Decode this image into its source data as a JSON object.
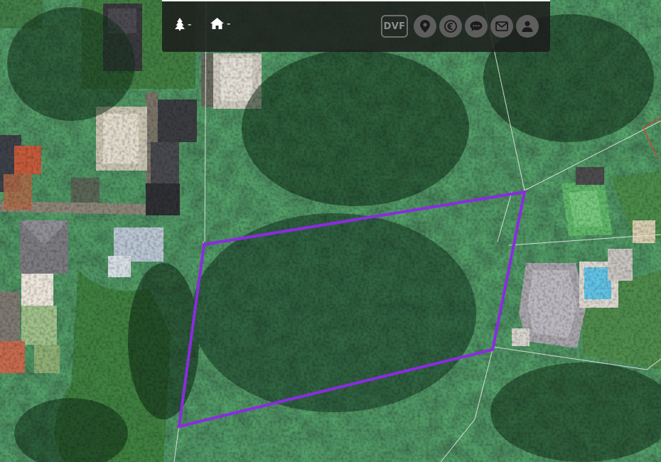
{
  "map": {
    "type": "satellite",
    "parcel_color": "#8a2be2",
    "boundary_color": "#e6e6e6",
    "neighbor_boundary_color": "#e03a2a"
  },
  "toolbar": {
    "trees_value": "-",
    "houses_value": "-",
    "dvf_label": "DVF",
    "icons": [
      "tree-icon",
      "house-icon",
      "map-pin-icon",
      "euro-icon",
      "chat-icon",
      "mail-icon",
      "user-icon"
    ]
  }
}
